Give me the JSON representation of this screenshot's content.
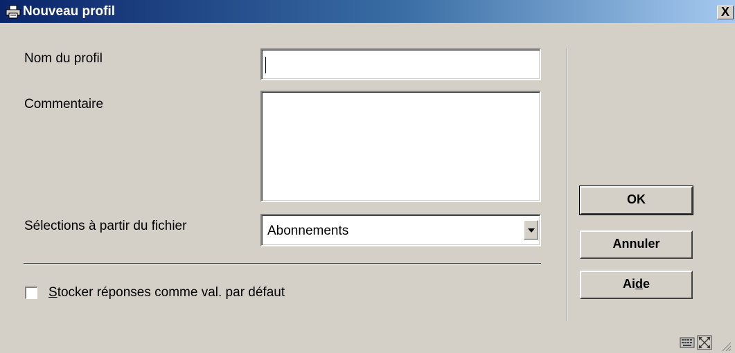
{
  "window": {
    "title": "Nouveau profil",
    "close_label": "X"
  },
  "form": {
    "profile_name_label": "Nom du profil",
    "profile_name_value": "",
    "comment_label": "Commentaire",
    "comment_value": "",
    "selection_label": "Sélections à partir du fichier",
    "selection_value": "Abonnements",
    "store_checkbox": {
      "label_mnemonic": "S",
      "label_rest": "tocker réponses comme val. par défaut",
      "checked": false
    }
  },
  "buttons": {
    "ok": "OK",
    "cancel": "Annuler",
    "help_pre": "Ai",
    "help_mnemonic": "d",
    "help_post": "e"
  },
  "icons": {
    "title": "printer-icon",
    "dropdown": "chevron-down-icon",
    "statusbar": [
      "keyboard-icon",
      "resize-icon",
      "grip-icon"
    ]
  }
}
